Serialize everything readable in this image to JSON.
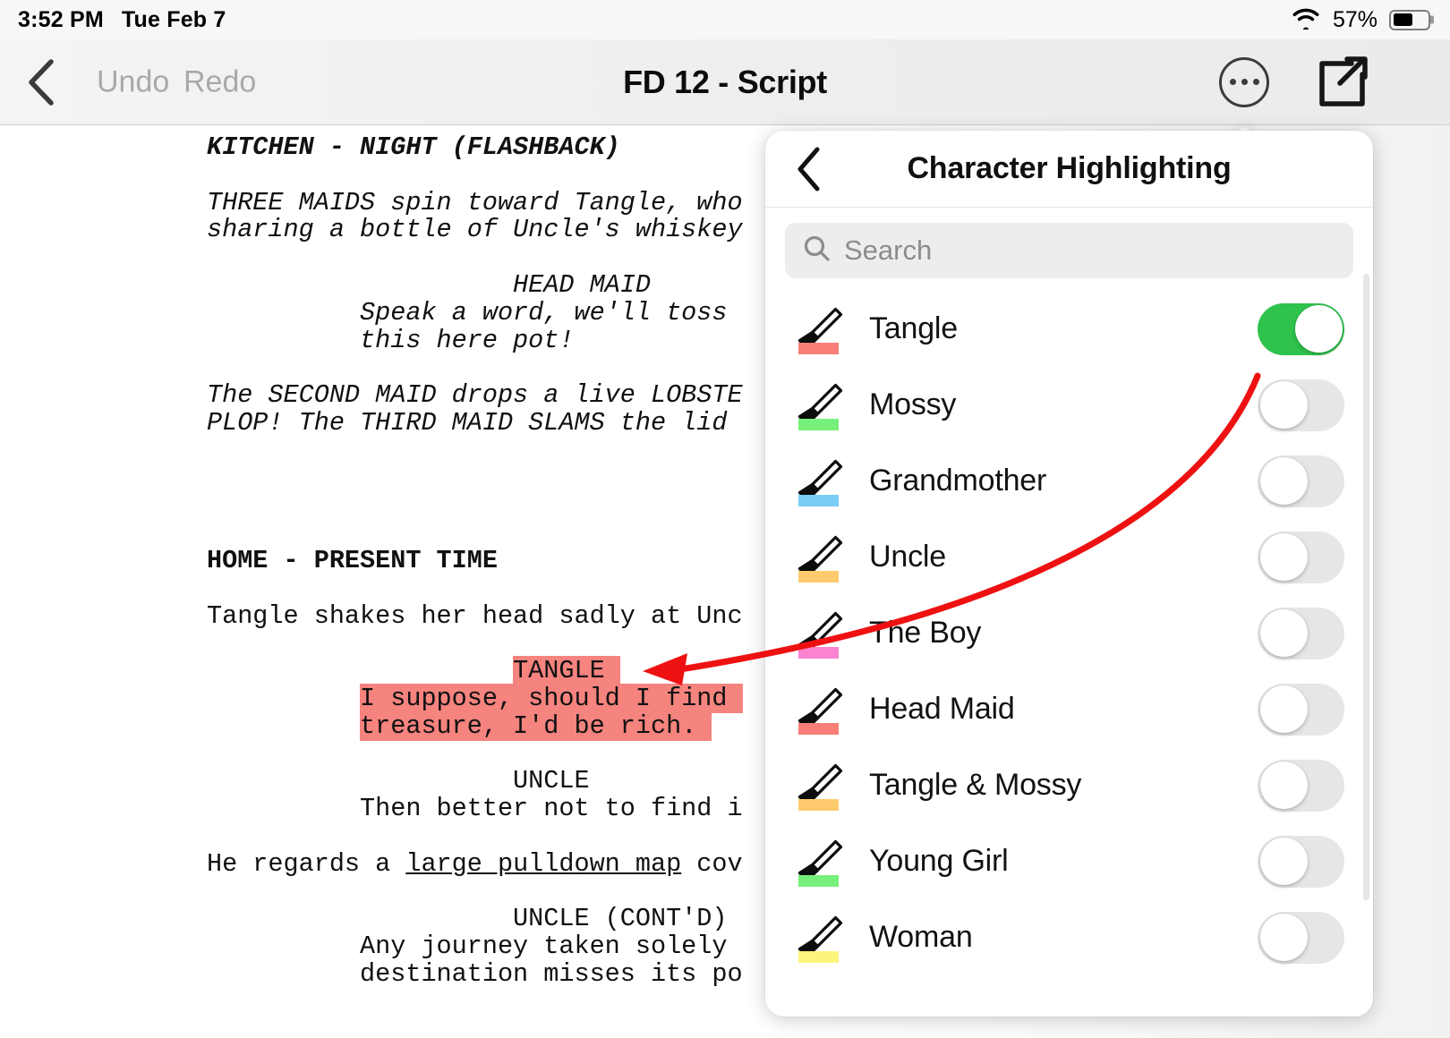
{
  "status_bar": {
    "time": "3:52 PM",
    "date": "Tue Feb 7",
    "battery_percent": "57%",
    "wifi_icon": "wifi-icon",
    "battery_icon": "battery-icon"
  },
  "nav_bar": {
    "back_icon": "chevron-left-icon",
    "undo_label": "Undo",
    "redo_label": "Redo",
    "title": "FD 12 - Script",
    "more_icon": "ellipsis-circle-icon",
    "share_icon": "share-export-icon"
  },
  "document": {
    "lines": [
      {
        "text": "KITCHEN - NIGHT (FLASHBACK)",
        "style": "bold-italic"
      },
      {
        "text": "",
        "style": "blank"
      },
      {
        "text": "THREE MAIDS spin toward Tangle, who",
        "style": "italic"
      },
      {
        "text": "sharing a bottle of Uncle's whiskey",
        "style": "italic"
      },
      {
        "text": "",
        "style": "blank"
      },
      {
        "text": "                    HEAD MAID",
        "style": "italic"
      },
      {
        "text": "          Speak a word, we'll toss",
        "style": "italic"
      },
      {
        "text": "          this here pot!",
        "style": "italic"
      },
      {
        "text": "",
        "style": "blank"
      },
      {
        "text": "The SECOND MAID drops a live LOBSTE",
        "style": "italic"
      },
      {
        "text": "PLOP! The THIRD MAID SLAMS the lid",
        "style": "italic"
      },
      {
        "text": "",
        "style": "blank"
      },
      {
        "text": "",
        "style": "blank"
      },
      {
        "text": "",
        "style": "blank"
      },
      {
        "text": "",
        "style": "blank"
      },
      {
        "text": "HOME - PRESENT TIME",
        "style": "bold"
      },
      {
        "text": "",
        "style": "blank"
      },
      {
        "text": "Tangle shakes her head sadly at Unc",
        "style": "plain"
      },
      {
        "text": "",
        "style": "blank"
      },
      {
        "text": "                    TANGLE",
        "style": "highlight-name"
      },
      {
        "text": "          I suppose, should I find",
        "style": "highlight"
      },
      {
        "text": "          treasure, I'd be rich.",
        "style": "highlight"
      },
      {
        "text": "",
        "style": "blank"
      },
      {
        "text": "                    UNCLE",
        "style": "plain"
      },
      {
        "text": "          Then better not to find i",
        "style": "plain"
      },
      {
        "text": "",
        "style": "blank"
      },
      {
        "text": "He regards a large pulldown map cov",
        "style": "underline-map"
      },
      {
        "text": "",
        "style": "blank"
      },
      {
        "text": "                    UNCLE (CONT'D)",
        "style": "plain"
      },
      {
        "text": "          Any journey taken solely",
        "style": "plain"
      },
      {
        "text": "          destination misses its po",
        "style": "plain"
      }
    ],
    "highlight_color": "#f5837e",
    "underlined_phrase": "large pulldown map"
  },
  "popover": {
    "back_icon": "chevron-left-icon",
    "title": "Character Highlighting",
    "search": {
      "icon": "search-icon",
      "placeholder": "Search",
      "value": ""
    },
    "toggle_on_color": "#2fc24d",
    "toggle_off_color": "#e6e6e7",
    "characters": [
      {
        "name": "Tangle",
        "color": "#f97e77",
        "enabled": true
      },
      {
        "name": "Mossy",
        "color": "#76f07a",
        "enabled": false
      },
      {
        "name": "Grandmother",
        "color": "#78cef4",
        "enabled": false
      },
      {
        "name": "Uncle",
        "color": "#fdcb6e",
        "enabled": false
      },
      {
        "name": "The Boy",
        "color": "#fb83d0",
        "enabled": false
      },
      {
        "name": "Head Maid",
        "color": "#f97e77",
        "enabled": false
      },
      {
        "name": "Tangle & Mossy",
        "color": "#fdcb6e",
        "enabled": false
      },
      {
        "name": "Young Girl",
        "color": "#76f07a",
        "enabled": false
      },
      {
        "name": "Woman",
        "color": "#fbf47d",
        "enabled": false
      }
    ]
  },
  "annotation": {
    "arrow_color": "#ee1111",
    "description": "red-arrow-from-tangle-toggle-to-highlighted-dialogue"
  }
}
